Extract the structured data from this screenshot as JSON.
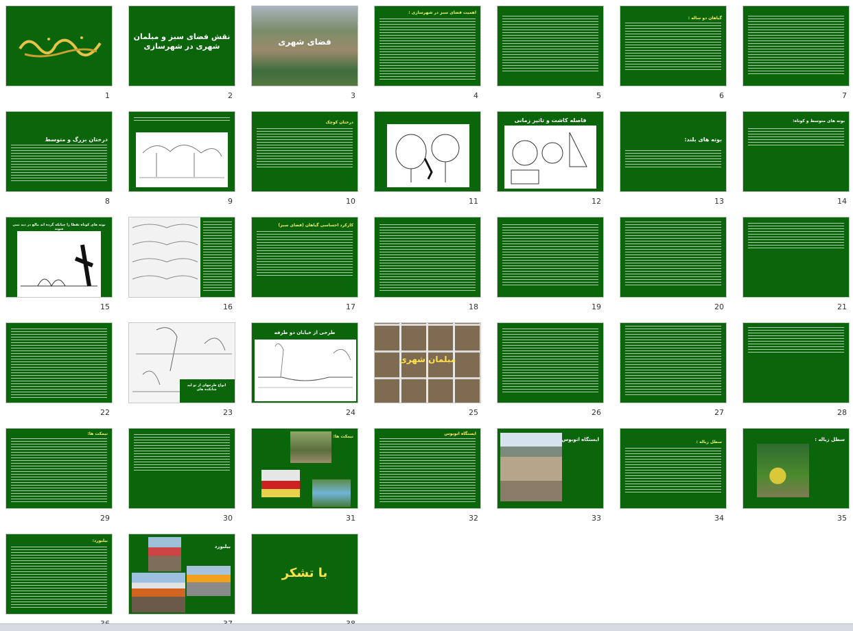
{
  "slides": [
    {
      "n": "1",
      "title": "بسم الله الرحمن الرحیم"
    },
    {
      "n": "2",
      "title": "نقش فضای سبز و مبلمان شهری در شهرسازی"
    },
    {
      "n": "3",
      "title": "فضای شهری"
    },
    {
      "n": "4",
      "title": "اهمیت فضای سبز در شهرسازی :"
    },
    {
      "n": "5",
      "title": ""
    },
    {
      "n": "6",
      "title": "گیاهان دو ساله :"
    },
    {
      "n": "7",
      "title": ""
    },
    {
      "n": "8",
      "title": "درختان بزرگ و متوسط"
    },
    {
      "n": "9",
      "title": ""
    },
    {
      "n": "10",
      "title": "درختان کوچک"
    },
    {
      "n": "11",
      "title": ""
    },
    {
      "n": "12",
      "title": "فاصله کاشت و تاثیر زمانی"
    },
    {
      "n": "13",
      "title": "بوته های بلند:"
    },
    {
      "n": "14",
      "title": "بوته های متوسط و کوتاه:"
    },
    {
      "n": "15",
      "title": "بوته های کوتاه تقطا را چنانکه گرده اند مالع در دید نمی شوند"
    },
    {
      "n": "16",
      "title": ""
    },
    {
      "n": "17",
      "title": "کارکرد احساسی گیاهان (فضای سبز)"
    },
    {
      "n": "18",
      "title": ""
    },
    {
      "n": "19",
      "title": ""
    },
    {
      "n": "20",
      "title": ""
    },
    {
      "n": "21",
      "title": ""
    },
    {
      "n": "22",
      "title": ""
    },
    {
      "n": "23",
      "title": "انواع طرحهای از تو لید شاتکده های"
    },
    {
      "n": "24",
      "title": "طرحی از خیابان دو طرفه"
    },
    {
      "n": "25",
      "title": "مبلمان شهری"
    },
    {
      "n": "26",
      "title": ""
    },
    {
      "n": "27",
      "title": ""
    },
    {
      "n": "28",
      "title": ""
    },
    {
      "n": "29",
      "title": "نیمکت ها:"
    },
    {
      "n": "30",
      "title": ""
    },
    {
      "n": "31",
      "title": "نیمکت ها:"
    },
    {
      "n": "32",
      "title": "ایستگاه اتوبوس"
    },
    {
      "n": "33",
      "title": "ایستگاه اتوبوس:"
    },
    {
      "n": "34",
      "title": "سطل زباله :"
    },
    {
      "n": "35",
      "title": "سطل زباله :"
    },
    {
      "n": "36",
      "title": "بیلبورد:"
    },
    {
      "n": "37",
      "title": "بیلبورد"
    },
    {
      "n": "38",
      "title": "با تشکر"
    }
  ]
}
